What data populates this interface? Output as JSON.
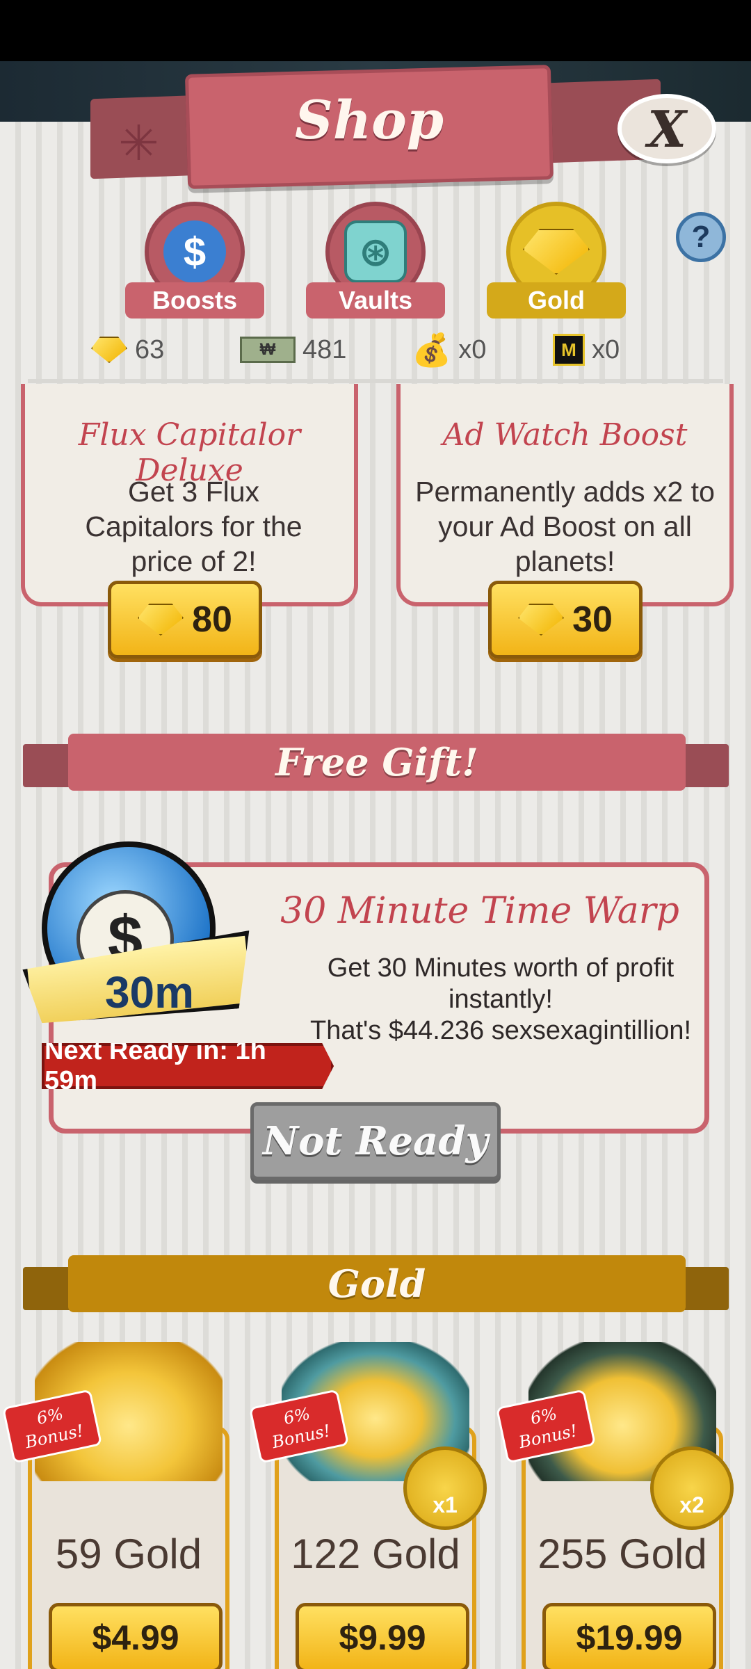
{
  "header": {
    "title": "Shop",
    "close_label": "X"
  },
  "tabs": [
    {
      "label": "Boosts",
      "icon": "stopwatch-icon",
      "active": false
    },
    {
      "label": "Vaults",
      "icon": "vault-icon",
      "active": false
    },
    {
      "label": "Gold",
      "icon": "gold-gem-icon",
      "active": true
    }
  ],
  "help_label": "?",
  "currencies": {
    "gold": "63",
    "megabucks": "481",
    "megabucks_symbol": "₩",
    "boost_bags": "x0",
    "chips": "x0"
  },
  "products": [
    {
      "title": "Flux Capitalor Deluxe",
      "description": "Get 3 Flux Capitalors for the price of 2!",
      "price": "80"
    },
    {
      "title": "Ad Watch Boost",
      "description": "Permanently adds x2 to your Ad Boost on all planets!",
      "price": "30"
    }
  ],
  "free_gift": {
    "section_title": "Free Gift!",
    "title": "30 Minute Time Warp",
    "description_line1": "Get 30 Minutes worth of profit instantly!",
    "description_line2": "That's $44.236 sexsexagintillion!",
    "badge": "30m",
    "timer": "Next Ready in: 1h 59m",
    "button_label": "Not Ready"
  },
  "gold_section": {
    "title": "Gold",
    "items": [
      {
        "bonus_line1": "6%",
        "bonus_line2": "Bonus!",
        "label": "59 Gold",
        "price": "$4.99",
        "multiplier": ""
      },
      {
        "bonus_line1": "6%",
        "bonus_line2": "Bonus!",
        "label": "122 Gold",
        "price": "$9.99",
        "multiplier": "x1"
      },
      {
        "bonus_line1": "6%",
        "bonus_line2": "Bonus!",
        "label": "255 Gold",
        "price": "$19.99",
        "multiplier": "x2"
      }
    ]
  },
  "colors": {
    "accent_red": "#c9636d",
    "gold_yellow": "#f2b417",
    "gold_section": "#c1880c"
  }
}
